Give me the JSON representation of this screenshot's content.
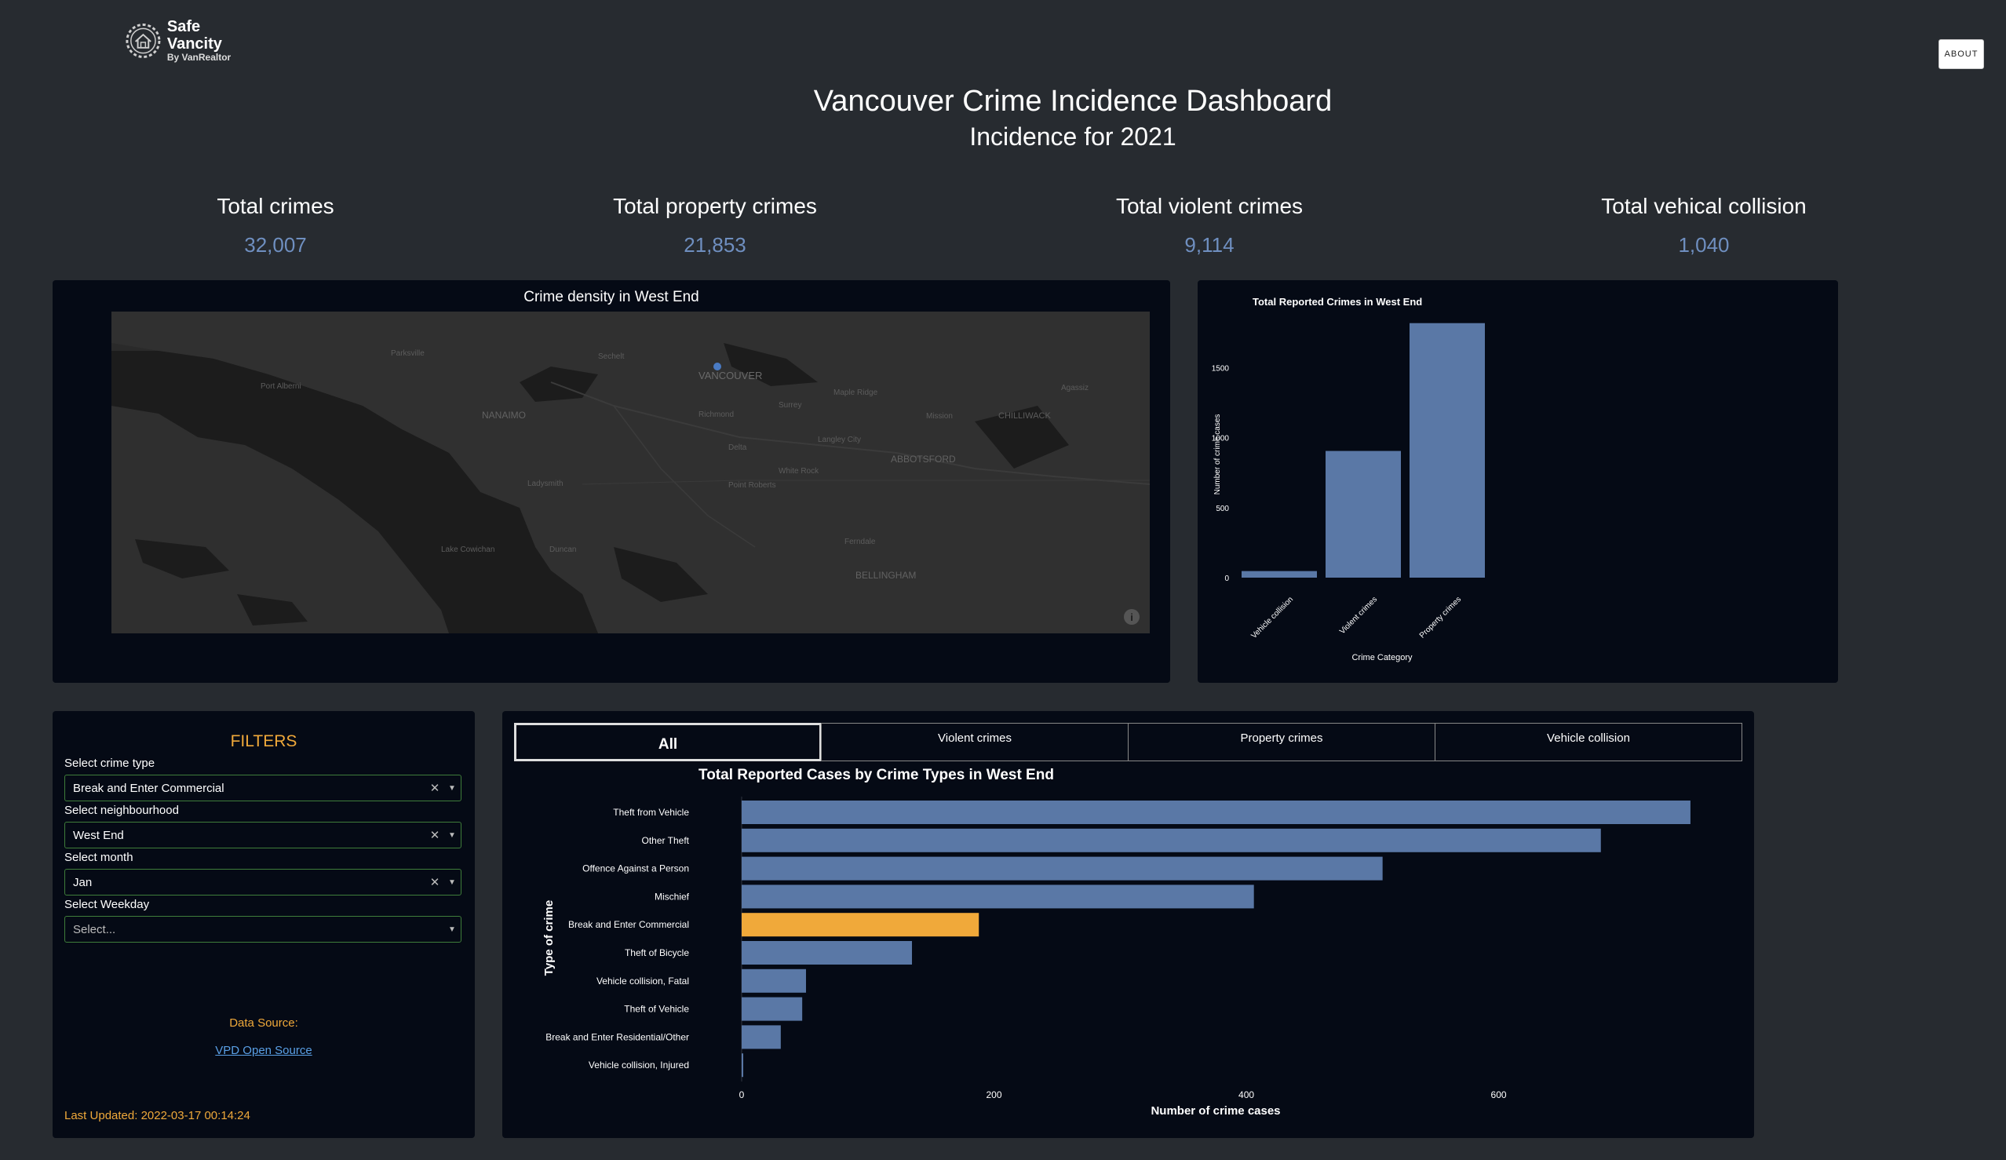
{
  "header": {
    "logo_title": "Safe Vancity",
    "logo_subtitle": "By VanRealtor",
    "about_label": "ABOUT",
    "title": "Vancouver Crime Incidence Dashboard",
    "subtitle": "Incidence for 2021"
  },
  "stats": [
    {
      "label": "Total crimes",
      "value": "32,007"
    },
    {
      "label": "Total property crimes",
      "value": "21,853"
    },
    {
      "label": "Total violent crimes",
      "value": "9,114"
    },
    {
      "label": "Total vehical collision",
      "value": "1,040"
    }
  ],
  "map": {
    "title": "Crime density in West End",
    "place_labels": [
      "VANCOUVER",
      "NANAIMO",
      "ABBOTSFORD",
      "CHILLIWACK",
      "BELLINGHAM",
      "Port Alberni",
      "Richmond",
      "Surrey",
      "Delta",
      "Langley City",
      "Maple Ridge",
      "Mission",
      "Ladysmith",
      "Duncan",
      "Lake Cowichan",
      "Parksville",
      "Agassiz",
      "White Rock",
      "Ferndale",
      "Sechelt",
      "Point Roberts"
    ]
  },
  "filters": {
    "title": "FILTERS",
    "crime_type": {
      "label": "Select crime type",
      "value": "Break and Enter Commercial"
    },
    "neighbourhood": {
      "label": "Select neighbourhood",
      "value": "West End"
    },
    "month": {
      "label": "Select month",
      "value": "Jan"
    },
    "weekday": {
      "label": "Select Weekday",
      "placeholder": "Select..."
    },
    "data_source_label": "Data Source:",
    "data_source_link": "VPD Open Source",
    "last_updated": "Last Updated: 2022-03-17 00:14:24"
  },
  "tabs": [
    {
      "label": "All",
      "active": true
    },
    {
      "label": "Violent crimes",
      "active": false
    },
    {
      "label": "Property crimes",
      "active": false
    },
    {
      "label": "Vehicle collision",
      "active": false
    }
  ],
  "colors": {
    "background": "#272b30",
    "panel": "#050a15",
    "bar": "#5a78a6",
    "highlight": "#f0a93a",
    "stat_value": "#6f8fc0",
    "link": "#5aa0e6"
  },
  "chart_data": [
    {
      "type": "bar",
      "title": "Total Reported Crimes in West End",
      "xlabel": "Crime Category",
      "ylabel": "Number of crime cases",
      "categories": [
        "Vehicle collision",
        "Violent crimes",
        "Property crimes"
      ],
      "values": [
        47,
        905,
        1818
      ],
      "ylim": [
        0,
        1850
      ],
      "yticks": [
        0,
        500,
        1000,
        1500
      ]
    },
    {
      "type": "bar",
      "orientation": "horizontal",
      "title": "Total Reported Cases by Crime Types in West End",
      "xlabel": "Number of crime cases",
      "ylabel": "Type of crime",
      "categories": [
        "Theft from Vehicle",
        "Other Theft",
        "Offence Against a Person",
        "Mischief",
        "Break and Enter Commercial",
        "Theft of Bicycle",
        "Vehicle collision, Fatal",
        "Theft of Vehicle",
        "Break and Enter Residential/Other",
        "Vehicle collision, Injured"
      ],
      "values": [
        752,
        681,
        508,
        406,
        188,
        135,
        51,
        48,
        31,
        1
      ],
      "highlight": "Break and Enter Commercial",
      "xlim": [
        0,
        790
      ],
      "xticks": [
        0,
        200,
        400,
        600
      ]
    }
  ]
}
